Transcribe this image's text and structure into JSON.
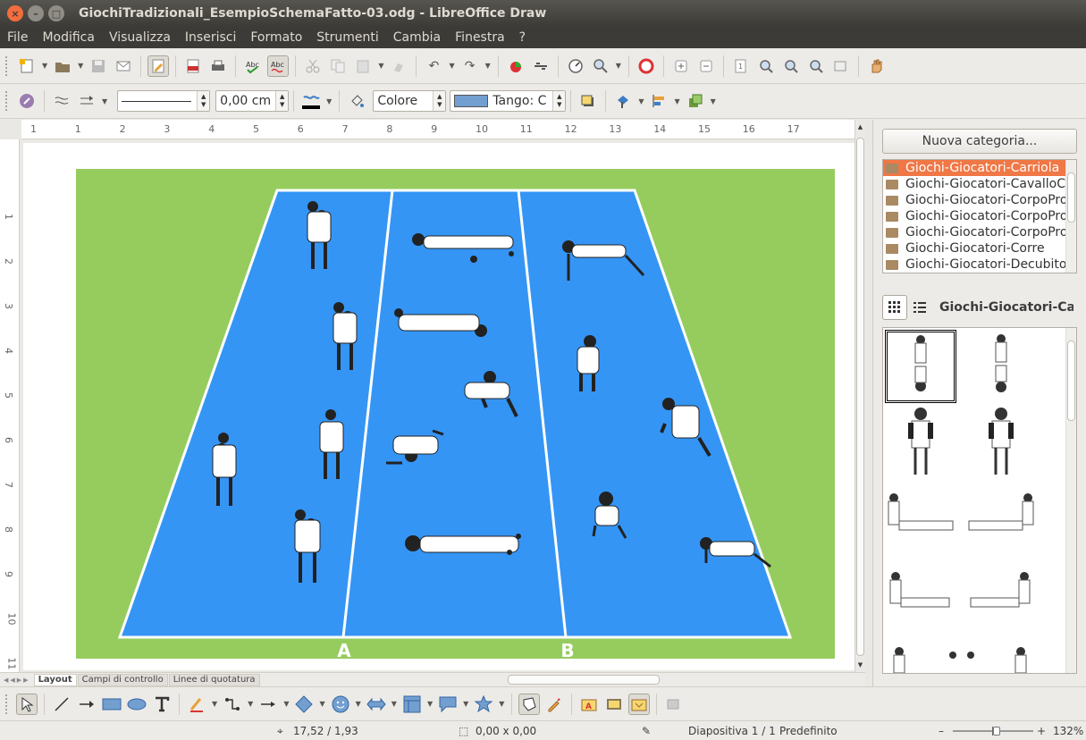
{
  "window": {
    "title": "GiochiTradizionali_EsempioSchemaFatto-03.odg - LibreOffice Draw",
    "close_glyph": "×",
    "min_glyph": "–",
    "max_glyph": "□"
  },
  "menu": [
    "File",
    "Modifica",
    "Visualizza",
    "Inserisci",
    "Formato",
    "Strumenti",
    "Cambia",
    "Finestra",
    "?"
  ],
  "line_toolbar": {
    "line_width": "0,00 cm",
    "area_style": "Colore",
    "area_color": "Tango: C"
  },
  "ruler": {
    "h_labels": [
      "1",
      "1",
      "2",
      "3",
      "4",
      "5",
      "6",
      "7",
      "8",
      "9",
      "10",
      "11",
      "12",
      "13",
      "14",
      "15",
      "16",
      "17"
    ],
    "v_labels": [
      "1",
      "2",
      "3",
      "4",
      "5",
      "6",
      "7",
      "8",
      "9",
      "10",
      "11"
    ]
  },
  "drawing": {
    "court_labels": [
      "A",
      "B"
    ],
    "colors": {
      "grass": "#96cc5e",
      "court": "#3595f5",
      "lines": "#ffffff"
    }
  },
  "tabs": [
    "Layout",
    "Campi di controllo",
    "Linee di quotatura"
  ],
  "sidebar": {
    "new_category_label": "Nuova categoria...",
    "categories": [
      "Giochi-Giocatori-Carriola",
      "Giochi-Giocatori-CavalloCav",
      "Giochi-Giocatori-CorpoPro",
      "Giochi-Giocatori-CorpoPro",
      "Giochi-Giocatori-CorpoPro",
      "Giochi-Giocatori-Corre",
      "Giochi-Giocatori-DecubitoL"
    ],
    "selected_category": "Giochi-Giocatori-Carriola",
    "gallery_title": "Giochi-Giocatori-Carr",
    "accent_color": "#f07746"
  },
  "status": {
    "position": "17,52 / 1,93",
    "size": "0,00 x 0,00",
    "slide": "Diapositiva 1 / 1",
    "layout": "Predefinito",
    "zoom": "132%"
  }
}
